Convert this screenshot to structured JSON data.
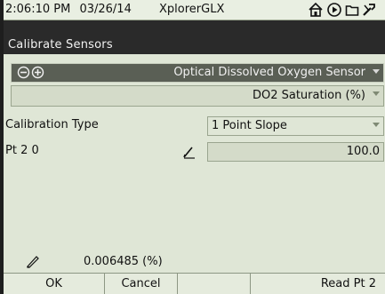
{
  "status_bar": {
    "time": "2:06:10 PM",
    "date": "03/26/14",
    "app_name": "XplorerGLX",
    "icons": [
      "home-icon",
      "play-icon",
      "folder-icon",
      "tools-icon"
    ]
  },
  "title": "Calibrate Sensors",
  "sensor": {
    "name": "Optical Dissolved Oxygen Sensor",
    "icons": [
      "minus-circle-icon",
      "plus-circle-icon"
    ]
  },
  "measurement": "DO2 Saturation (%)",
  "calibration_type": {
    "label": "Calibration Type",
    "selected": "1 Point Slope"
  },
  "point": {
    "label": "Pt 2 0",
    "value": "100.0"
  },
  "reading": "0.006485 (%)",
  "softkeys": {
    "ok": "OK",
    "cancel": "Cancel",
    "empty": "",
    "read": "Read Pt 2"
  },
  "colors": {
    "screen": "#dfe6d6",
    "titlebar": "#2a2a2a",
    "sensor_row": "#5a5f55"
  }
}
